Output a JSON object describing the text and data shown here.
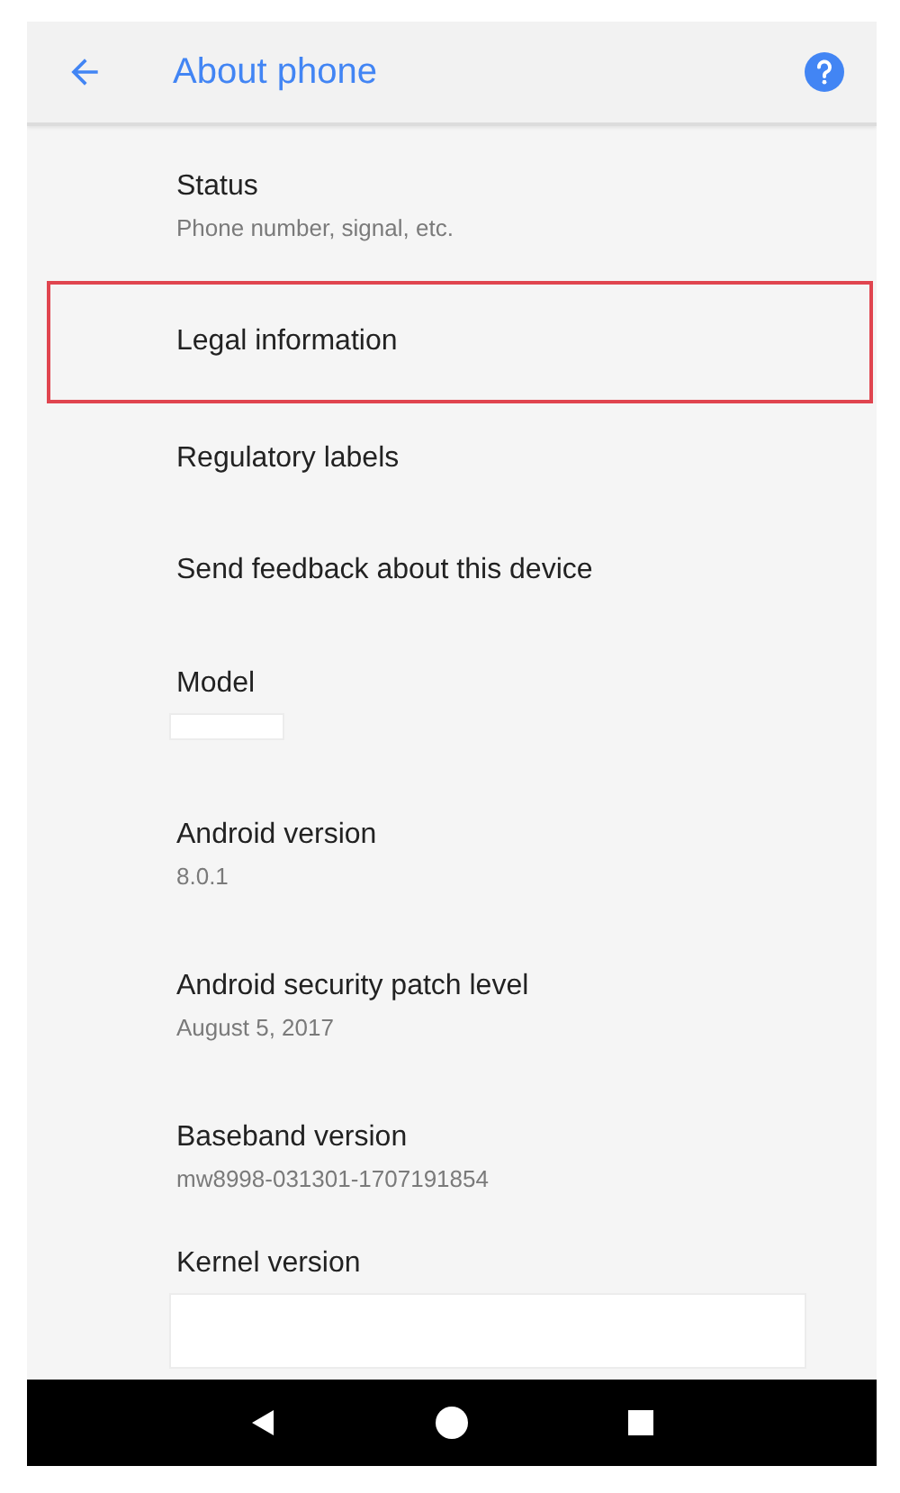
{
  "app_bar": {
    "title": "About phone"
  },
  "items": [
    {
      "title": "Status",
      "summary": "Phone number, signal, etc.",
      "highlighted": false,
      "summary_redacted": false
    },
    {
      "title": "Legal information",
      "highlighted": true,
      "summary_redacted": false
    },
    {
      "title": "Regulatory labels",
      "highlighted": false,
      "summary_redacted": false
    },
    {
      "title": "Send feedback about this device",
      "highlighted": false,
      "summary_redacted": false
    },
    {
      "title": "Model",
      "highlighted": false,
      "summary_redacted": true
    },
    {
      "title": "Android version",
      "summary": "8.0.1",
      "highlighted": false,
      "summary_redacted": false
    },
    {
      "title": "Android security patch level",
      "summary": "August 5, 2017",
      "highlighted": false,
      "summary_redacted": false
    },
    {
      "title": "Baseband version",
      "summary": "mw8998-031301-1707191854",
      "highlighted": false,
      "summary_redacted": false
    },
    {
      "title": "Kernel version",
      "highlighted": false,
      "summary_redacted": true
    }
  ]
}
